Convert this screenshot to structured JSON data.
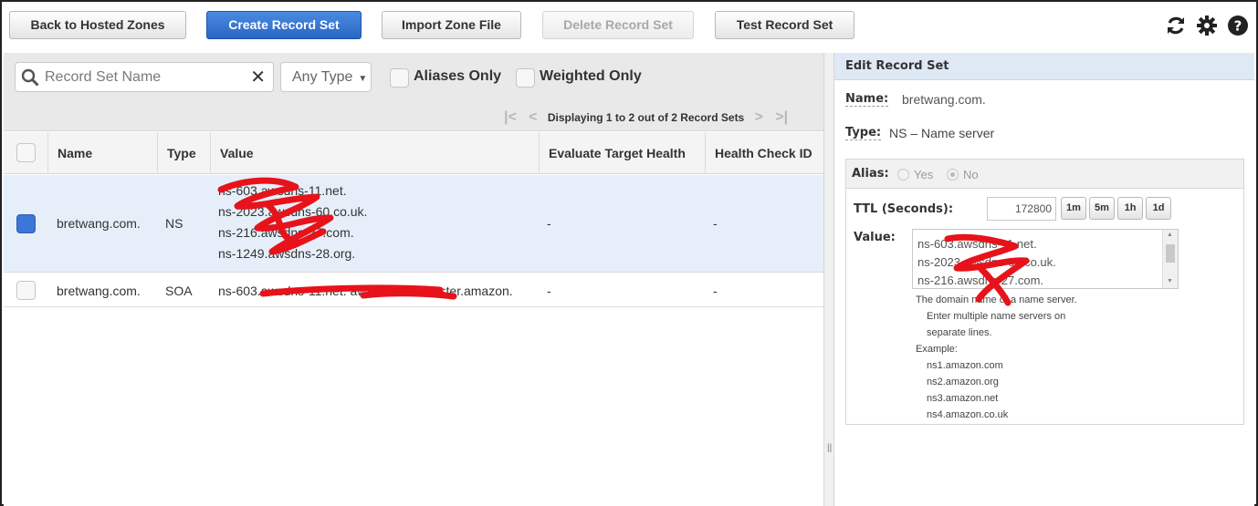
{
  "toolbar": {
    "back_label": "Back to Hosted Zones",
    "create_label": "Create Record Set",
    "import_label": "Import Zone File",
    "delete_label": "Delete Record Set",
    "test_label": "Test Record Set",
    "icons": [
      "refresh-icon",
      "gear-icon",
      "help-icon"
    ]
  },
  "filters": {
    "search_placeholder": "Record Set Name",
    "clear_glyph": "✕",
    "type_select": "Any Type",
    "aliases_only": "Aliases Only",
    "weighted_only": "Weighted Only",
    "pager_text": "Displaying 1 to 2 out of 2 Record Sets"
  },
  "table": {
    "columns": [
      "Name",
      "Type",
      "Value",
      "Evaluate Target Health",
      "Health Check ID"
    ],
    "rows": [
      {
        "name": "bretwang.com.",
        "type": "NS",
        "value_lines": [
          "ns-603.awsdns-11.net.",
          "ns-2023.awsdns-60.co.uk.",
          "ns-216.awsdns-27.com.",
          "ns-1249.awsdns-28.org."
        ],
        "eval": "-",
        "health": "-",
        "selected": true
      },
      {
        "name": "bretwang.com.",
        "type": "SOA",
        "value_lines": [
          "ns-603.awsdns-11.net. awsdns-hostmaster.amazon."
        ],
        "eval": "-",
        "health": "-",
        "selected": false
      }
    ]
  },
  "edit_panel": {
    "title": "Edit Record Set",
    "name_label": "Name:",
    "name_value": "bretwang.com.",
    "type_label": "Type:",
    "type_value": "NS – Name server",
    "alias_label": "Alias:",
    "alias_yes": "Yes",
    "alias_no": "No",
    "ttl_label": "TTL (Seconds):",
    "ttl_value": "172800",
    "ttl_buttons": [
      "1m",
      "5m",
      "1h",
      "1d"
    ],
    "value_label": "Value:",
    "value_lines": [
      "ns-603.awsdns-11.net.",
      "ns-2023.awsdns-60.co.uk.",
      "ns-216.awsdns-27.com."
    ],
    "help_lines": [
      "The domain name of a name server.",
      "Enter multiple name servers on",
      "separate lines.",
      "Example:",
      "ns1.amazon.com",
      "ns2.amazon.org",
      "ns3.amazon.net",
      "ns4.amazon.co.uk"
    ]
  },
  "colors": {
    "primary": "#2a66c4",
    "selected_row": "#e6eff9",
    "panel_title_bg": "#dfe9f5",
    "redaction": "#e8121b"
  }
}
